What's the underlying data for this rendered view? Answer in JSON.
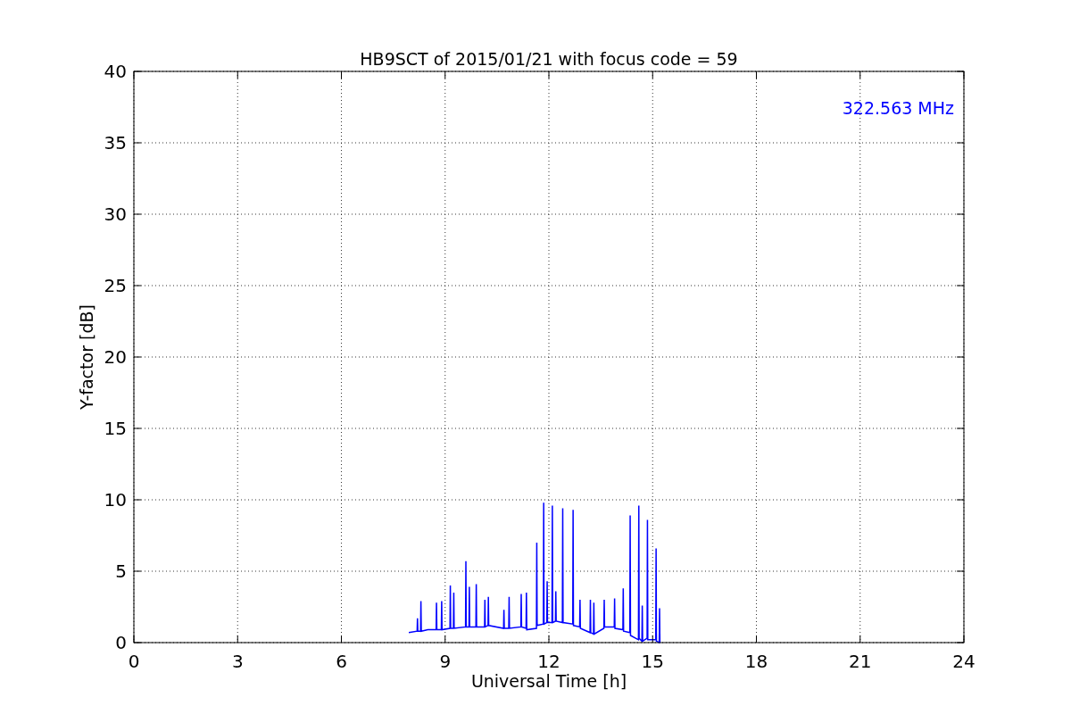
{
  "chart_data": {
    "type": "line",
    "title": "HB9SCT of 2015/01/21 with focus code = 59",
    "xlabel": "Universal Time [h]",
    "ylabel": "Y-factor [dB]",
    "xlim": [
      0,
      24
    ],
    "ylim": [
      0,
      40
    ],
    "xticks": [
      0,
      3,
      6,
      9,
      12,
      15,
      18,
      21,
      24
    ],
    "yticks": [
      0,
      5,
      10,
      15,
      20,
      25,
      30,
      35,
      40
    ],
    "x": [
      7.95,
      8.19,
      8.2,
      8.21,
      8.29,
      8.3,
      8.31,
      8.5,
      8.74,
      8.75,
      8.76,
      8.89,
      8.9,
      8.91,
      9.14,
      9.15,
      9.16,
      9.24,
      9.25,
      9.26,
      9.59,
      9.6,
      9.61,
      9.69,
      9.7,
      9.71,
      9.89,
      9.9,
      9.91,
      10.14,
      10.15,
      10.16,
      10.24,
      10.25,
      10.26,
      10.69,
      10.7,
      10.71,
      10.84,
      10.85,
      10.86,
      11.19,
      11.2,
      11.21,
      11.34,
      11.35,
      11.36,
      11.64,
      11.65,
      11.66,
      11.84,
      11.85,
      11.86,
      11.94,
      11.95,
      11.96,
      12.09,
      12.1,
      12.11,
      12.19,
      12.2,
      12.21,
      12.39,
      12.4,
      12.41,
      12.69,
      12.7,
      12.71,
      12.89,
      12.9,
      12.91,
      13.19,
      13.2,
      13.21,
      13.29,
      13.3,
      13.31,
      13.59,
      13.6,
      13.61,
      13.89,
      13.9,
      13.91,
      14.14,
      14.15,
      14.16,
      14.34,
      14.35,
      14.36,
      14.59,
      14.6,
      14.61,
      14.69,
      14.7,
      14.71,
      14.84,
      14.85,
      14.86,
      15.09,
      15.1,
      15.11,
      15.19,
      15.2,
      15.21
    ],
    "series": [
      {
        "name": "322.563 MHz",
        "color": "#0000ff",
        "values": [
          0.7,
          0.8,
          1.7,
          0.8,
          0.8,
          2.9,
          0.8,
          0.9,
          0.9,
          2.8,
          0.9,
          0.9,
          2.9,
          0.9,
          1.0,
          4.0,
          1.0,
          1.0,
          3.5,
          1.0,
          1.1,
          5.7,
          1.1,
          1.1,
          3.9,
          1.1,
          1.1,
          4.1,
          1.1,
          1.1,
          3.0,
          1.1,
          1.2,
          3.2,
          1.2,
          1.0,
          2.3,
          1.0,
          1.0,
          3.2,
          1.0,
          1.1,
          3.4,
          1.1,
          1.0,
          3.5,
          0.9,
          1.0,
          7.0,
          1.2,
          1.3,
          9.8,
          1.3,
          1.4,
          4.3,
          1.4,
          1.4,
          9.6,
          1.4,
          1.5,
          3.6,
          1.5,
          1.4,
          9.4,
          1.4,
          1.3,
          9.3,
          1.2,
          1.1,
          3.0,
          1.0,
          0.7,
          3.0,
          0.7,
          0.6,
          2.8,
          0.6,
          1.0,
          3.0,
          1.1,
          1.1,
          3.1,
          1.0,
          0.9,
          3.8,
          0.8,
          0.7,
          8.9,
          0.5,
          0.2,
          9.6,
          0.3,
          0.1,
          2.6,
          0.1,
          0.3,
          8.6,
          0.2,
          0.2,
          6.6,
          0.1,
          0.0,
          2.4,
          0.0
        ]
      }
    ],
    "grid": true
  }
}
